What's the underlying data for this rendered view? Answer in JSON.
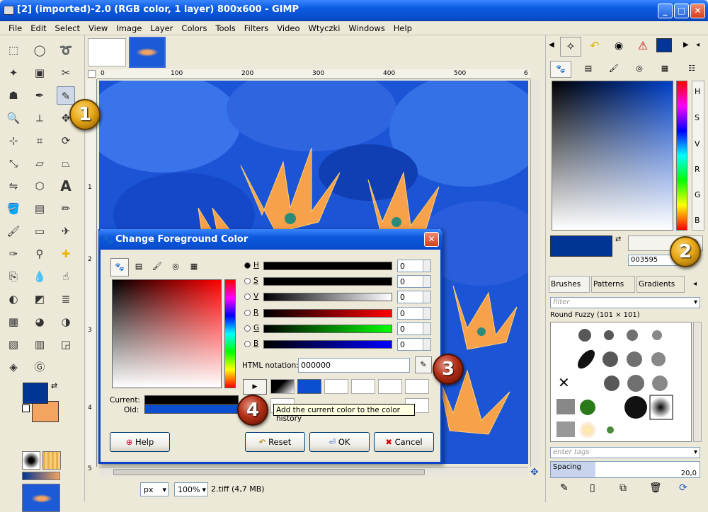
{
  "window": {
    "title": "[2] (imported)-2.0 (RGB color, 1 layer) 800x600 - GIMP"
  },
  "menu": [
    "File",
    "Edit",
    "Select",
    "View",
    "Image",
    "Layer",
    "Colors",
    "Tools",
    "Filters",
    "Video",
    "Wtyczki",
    "Windows",
    "Help"
  ],
  "ruler": {
    "top": [
      "0",
      "100",
      "200",
      "300",
      "400",
      "500",
      "6"
    ],
    "left": [
      "1",
      "2",
      "3",
      "4",
      "5"
    ]
  },
  "status": {
    "unit": "px",
    "zoom": "100%",
    "file": "2.tiff (4,7 MB)"
  },
  "dialog": {
    "title": "Change Foreground Color",
    "channels": [
      {
        "label": "H",
        "value": "0"
      },
      {
        "label": "S",
        "value": "0"
      },
      {
        "label": "V",
        "value": "0"
      },
      {
        "label": "R",
        "value": "0"
      },
      {
        "label": "G",
        "value": "0"
      },
      {
        "label": "B",
        "value": "0"
      }
    ],
    "html_label": "HTML notation:",
    "html_value": "000000",
    "current_label": "Current:",
    "old_label": "Old:",
    "tooltip": "Add the current color to the color history",
    "buttons": {
      "help": "Help",
      "reset": "Reset",
      "ok": "OK",
      "cancel": "Cancel"
    }
  },
  "dock": {
    "channel_tabs": [
      "H",
      "S",
      "V",
      "R",
      "G",
      "B"
    ],
    "hex_value": "003595",
    "tabs": {
      "brushes": "Brushes",
      "patterns": "Patterns",
      "gradients": "Gradients"
    },
    "filter_placeholder": "filter",
    "brush_name": "Round Fuzzy (101 × 101)",
    "tags_placeholder": "enter tags",
    "spacing_label": "Spacing",
    "spacing_value": "20,0"
  },
  "badges": [
    "1",
    "2",
    "3",
    "4"
  ],
  "colors": {
    "foreground": "#003595",
    "background": "#f4a460",
    "accent": "#0a4fd0"
  }
}
